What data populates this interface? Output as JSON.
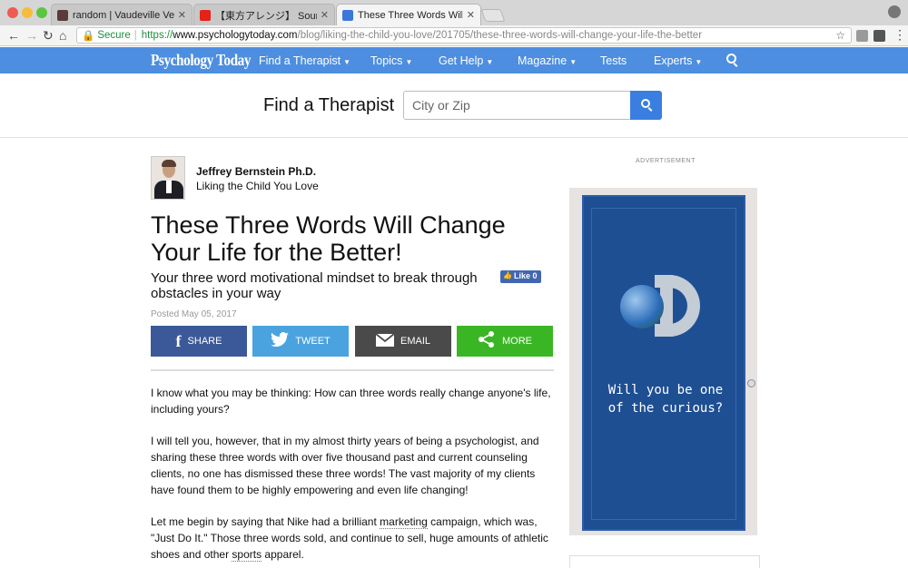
{
  "browser": {
    "tabs": [
      {
        "title": "random | Vaudeville Ventures",
        "favicon_color": "#5a3b3b"
      },
      {
        "title": "【東方アレンジ】 Sound of N",
        "favicon_color": "#e62117"
      },
      {
        "title": "These Three Words Will Chang",
        "favicon_color": "#3b78d8"
      }
    ],
    "address": {
      "secure_label": "Secure",
      "scheme": "https://",
      "host": "www.psychologytoday.com",
      "path": "/blog/liking-the-child-you-love/201705/these-three-words-will-change-your-life-the-better"
    }
  },
  "site": {
    "logo": "Psychology Today",
    "nav": {
      "find_therapist": "Find a Therapist",
      "topics": "Topics",
      "get_help": "Get Help",
      "magazine": "Magazine",
      "tests": "Tests",
      "experts": "Experts"
    },
    "brand_color": "#4d8ee0"
  },
  "therapist_search": {
    "label": "Find a Therapist",
    "placeholder": "City or Zip"
  },
  "article": {
    "author": "Jeffrey Bernstein Ph.D.",
    "blog": "Liking the Child You Love",
    "title": "These Three Words Will Change Your Life for the Better!",
    "subtitle": "Your three word motivational mindset to break through obstacles in your way",
    "like_label": "Like 0",
    "posted": "Posted May 05, 2017",
    "share": {
      "facebook": "SHARE",
      "twitter": "TWEET",
      "email": "EMAIL",
      "more": "MORE"
    },
    "paragraphs": [
      "I know what you may be thinking: How can three words really change anyone's life, including yours?",
      "I will tell you, however, that in my almost thirty years of being a psychologist, and sharing these three words with over five thousand past and current counseling clients, no one has dismissed these three words! The vast majority of my clients have found them to be highly empowering and even life changing!"
    ],
    "p3": {
      "a": "Let me begin by saying that Nike had a brilliant ",
      "link1": "marketing",
      "b": " campaign, which was, \"Just Do It.\"  Those three words sold, and continue to sell, huge amounts of athletic shoes and other ",
      "link2": "sports",
      "c": " apparel."
    }
  },
  "ad": {
    "label": "ADVERTISEMENT",
    "tagline": "Will you be one of the curious?"
  }
}
